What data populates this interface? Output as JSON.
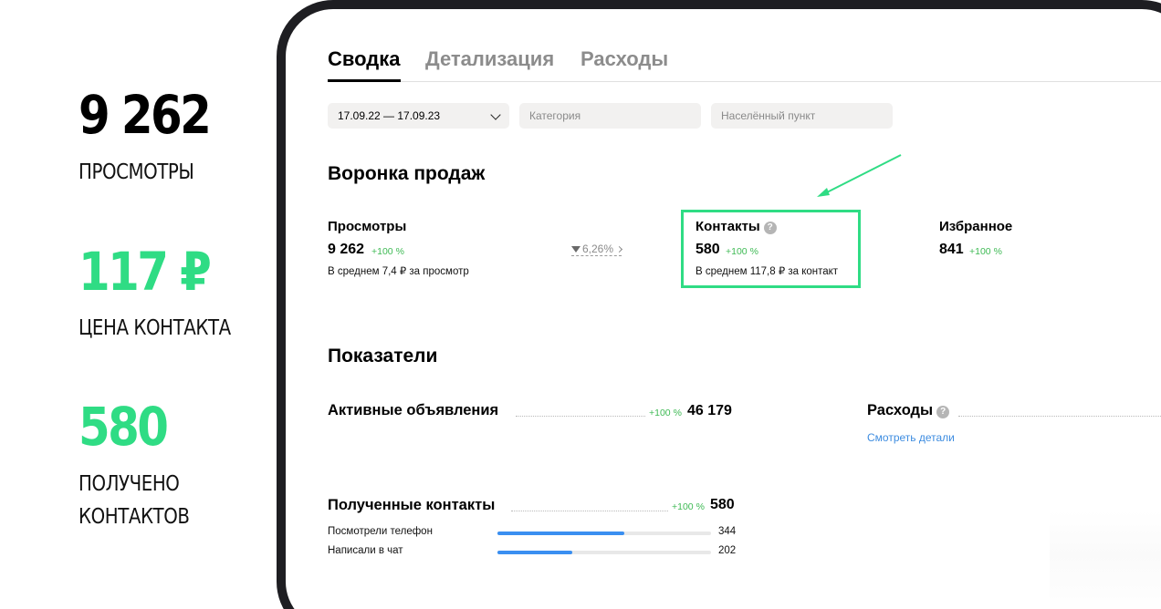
{
  "stats": [
    {
      "value": "9 262",
      "label_lines": [
        "ПРОСМОТРЫ"
      ],
      "color": "#1e1e22"
    },
    {
      "value": "117 ₽",
      "label_lines": [
        "ЦЕНА КОНТАКТА"
      ],
      "color": "#2fdc84"
    },
    {
      "value": "580",
      "label_lines": [
        "ПОЛУЧЕНО",
        "КОНТАКТОВ"
      ],
      "color": "#2fdc84"
    }
  ],
  "tabs": [
    {
      "label": "Сводка",
      "active": true
    },
    {
      "label": "Детализация",
      "active": false
    },
    {
      "label": "Расходы",
      "active": false
    }
  ],
  "filters": {
    "date_range": "17.09.22 — 17.09.23",
    "category_placeholder": "Категория",
    "city_placeholder": "Населённый пункт"
  },
  "funnel": {
    "title": "Воронка продаж",
    "conversion": "6,26%",
    "views": {
      "title": "Просмотры",
      "value": "9 262",
      "delta": "+100 %",
      "sub": "В среднем 7,4 ₽ за просмотр"
    },
    "contacts": {
      "title": "Контакты",
      "help": "?",
      "value": "580",
      "delta": "+100 %",
      "sub": "В среднем 117,8 ₽ за контакт"
    },
    "favorites": {
      "title": "Избранное",
      "value": "841",
      "delta": "+100 %"
    }
  },
  "metrics": {
    "title": "Показатели",
    "active_ads": {
      "title": "Активные объявления",
      "delta": "+100 %",
      "value": "46 179"
    },
    "expenses": {
      "title": "Расходы",
      "help": "?",
      "link": "Смотреть детали"
    },
    "received_contacts": {
      "title": "Полученные контакты",
      "delta": "+100 %",
      "value": "580"
    },
    "breakdown": [
      {
        "label": "Посмотрели телефон",
        "value": "344",
        "fraction": 0.593
      },
      {
        "label": "Написали в чат",
        "value": "202",
        "fraction": 0.349
      }
    ]
  },
  "colors": {
    "accent_green": "#2fdc84",
    "delta_green": "#3fba55",
    "link_blue": "#3d8ce0",
    "bar_blue": "#3a8ff1",
    "frame": "#1e1e22"
  },
  "icons": {
    "dropdown": "chevron-down-icon",
    "help": "question-circle-icon",
    "funnel": "funnel-icon",
    "annotation": "arrow-icon"
  }
}
